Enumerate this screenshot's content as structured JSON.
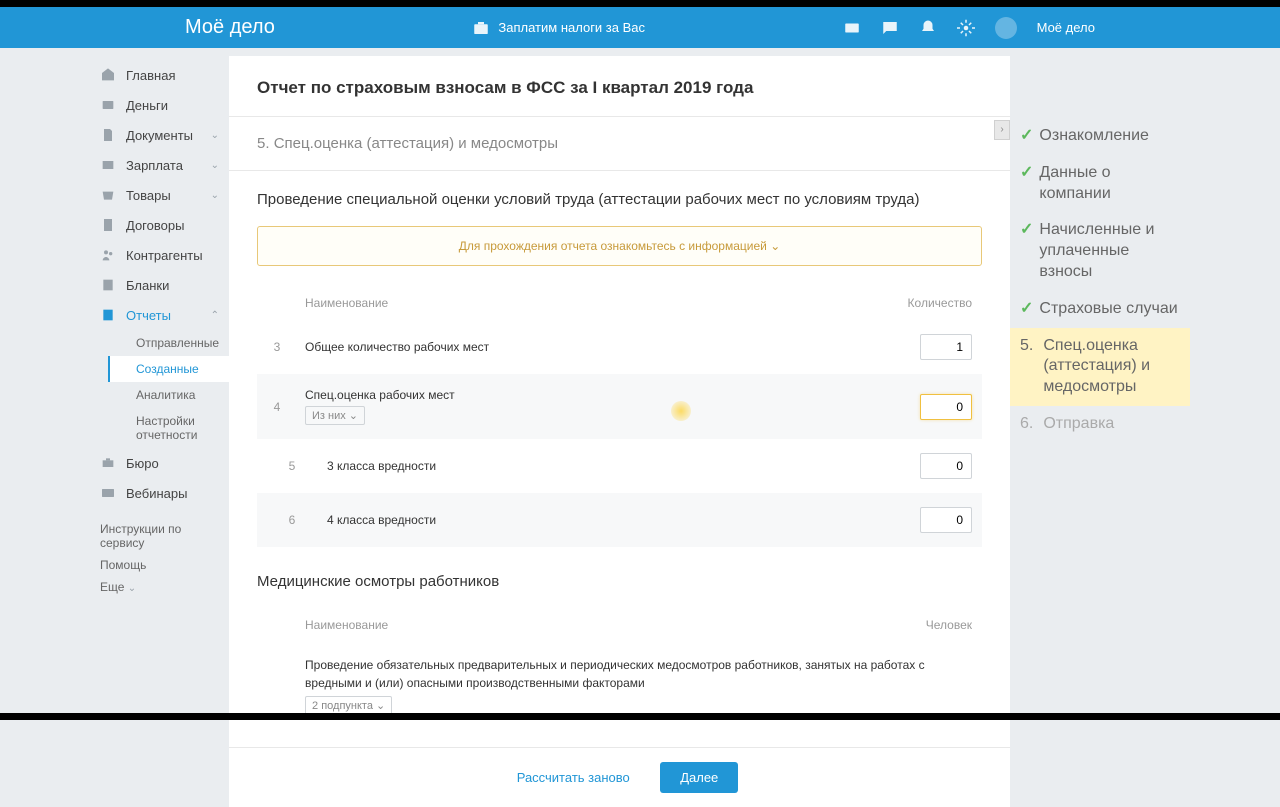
{
  "topbar": {
    "logo": "Моё дело",
    "banner": "Заплатим налоги за Вас",
    "username": "Моё дело"
  },
  "sidebar": {
    "items": [
      {
        "label": "Главная"
      },
      {
        "label": "Деньги"
      },
      {
        "label": "Документы",
        "expandable": true
      },
      {
        "label": "Зарплата",
        "expandable": true
      },
      {
        "label": "Товары",
        "expandable": true
      },
      {
        "label": "Договоры"
      },
      {
        "label": "Контрагенты"
      },
      {
        "label": "Бланки"
      },
      {
        "label": "Отчеты",
        "expandable": true,
        "active": true
      }
    ],
    "reports_sub": [
      {
        "label": "Отправленные"
      },
      {
        "label": "Созданные",
        "active": true
      },
      {
        "label": "Аналитика"
      },
      {
        "label": "Настройки отчетности"
      }
    ],
    "extra": [
      {
        "label": "Бюро"
      },
      {
        "label": "Вебинары"
      }
    ],
    "help": {
      "instructions": "Инструкции по сервису",
      "support": "Помощь",
      "more": "Еще"
    }
  },
  "page": {
    "title": "Отчет по страховым взносам в ФСС за I квартал 2019 года",
    "section": "5. Спец.оценка (аттестация) и медосмотры",
    "subsection1": "Проведение специальной оценки условий труда (аттестации рабочих мест по условиям труда)",
    "banner": "Для прохождения отчета ознакомьтесь с информацией",
    "table_headers": {
      "name": "Наименование",
      "qty": "Количество"
    },
    "rows": [
      {
        "num": "3",
        "name": "Общее количество рабочих мест",
        "value": "1"
      },
      {
        "num": "4",
        "name": "Спец.оценка рабочих мест",
        "tag": "Из них",
        "value": "0",
        "highlight": true
      },
      {
        "num": "5",
        "name": "3 класса вредности",
        "value": "0",
        "sub": true
      },
      {
        "num": "6",
        "name": "4 класса вредности",
        "value": "0",
        "sub": true
      }
    ],
    "subsection2": "Медицинские осмотры работников",
    "table2_headers": {
      "name": "Наименование",
      "qty": "Человек"
    },
    "row2": {
      "text": "Проведение обязательных предварительных и периодических медосмотров работников, занятых на работах с вредными и (или) опасными производственными факторами",
      "tag": "2 подпункта"
    },
    "footer": {
      "recalc": "Рассчитать заново",
      "next": "Далее"
    }
  },
  "steps": [
    {
      "label": "Ознакомление",
      "state": "done"
    },
    {
      "label": "Данные о компании",
      "state": "done"
    },
    {
      "label": "Начисленные и уплаченные взносы",
      "state": "done"
    },
    {
      "label": "Страховые случаи",
      "state": "done"
    },
    {
      "num": "5.",
      "label": "Спец.оценка (аттестация) и медосмотры",
      "state": "current"
    },
    {
      "num": "6.",
      "label": "Отправка",
      "state": "pending"
    }
  ]
}
